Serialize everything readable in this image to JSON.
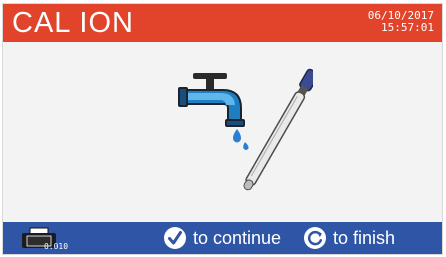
{
  "header": {
    "title": "CAL ION",
    "date": "06/10/2017",
    "time": "15:57:01"
  },
  "footer": {
    "printer_value": "0.010",
    "continue_label": "to continue",
    "finish_label": "to finish"
  },
  "colors": {
    "header": "#e1442a",
    "footer": "#2f56a6",
    "body": "#f3f3f3"
  },
  "icons": {
    "illustration": "faucet-electrode-icon",
    "printer": "printer-icon",
    "continue": "check-circle-icon",
    "finish": "refresh-circle-icon"
  }
}
